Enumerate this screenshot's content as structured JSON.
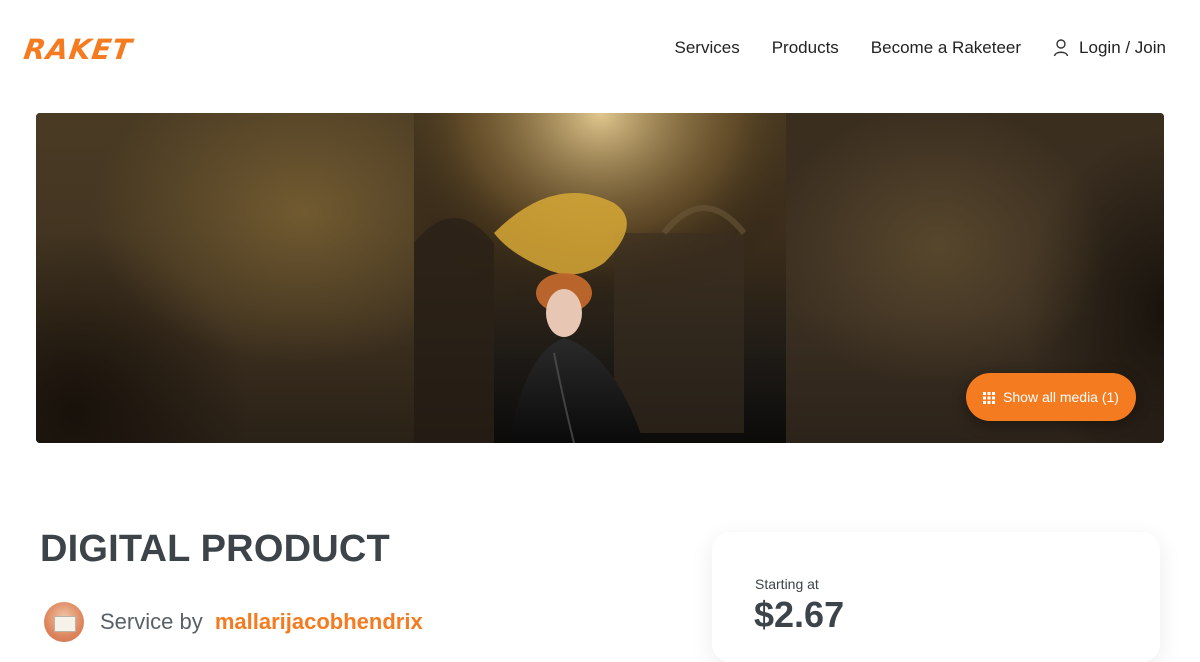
{
  "header": {
    "logo": "RAKET",
    "nav": {
      "services": "Services",
      "products": "Products",
      "become": "Become a Raketeer",
      "login": "Login / Join"
    }
  },
  "hero": {
    "show_media_label": "Show all media (1)"
  },
  "product": {
    "title": "DIGITAL PRODUCT",
    "service_by": "Service by",
    "seller_name": "mallarijacobhendrix"
  },
  "price_card": {
    "label": "Starting at",
    "price": "$2.67"
  },
  "colors": {
    "accent": "#f47b20",
    "text": "#3d4449"
  },
  "icons": {
    "user": "user-icon",
    "grid": "grid-icon"
  }
}
